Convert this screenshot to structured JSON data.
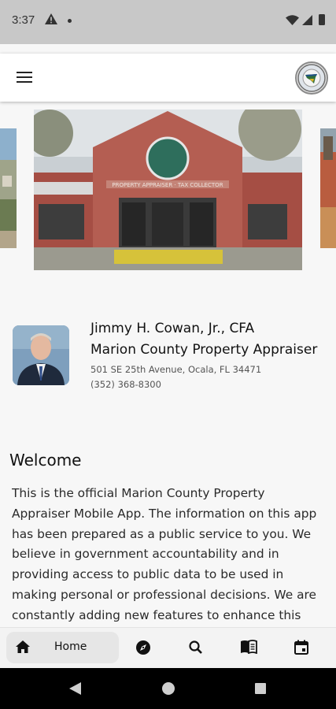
{
  "status_bar": {
    "time": "3:37",
    "icons": [
      "warning-icon",
      "notification-dot-icon",
      "wifi-icon",
      "signal-icon",
      "battery-icon"
    ]
  },
  "app_bar": {
    "menu_icon": "hamburger-menu-icon",
    "logo_icon": "county-seal-logo"
  },
  "carousel": {
    "slides": [
      "previous-slide-photo",
      "marion-county-property-appraiser-building-photo",
      "next-slide-photo"
    ]
  },
  "profile": {
    "name": "Jimmy H. Cowan, Jr., CFA",
    "title": "Marion County Property Appraiser",
    "address": "501 SE 25th Avenue, Ocala, FL 34471",
    "phone": "(352) 368-8300"
  },
  "welcome": {
    "heading": "Welcome",
    "body": "This is the official Marion County Property Appraiser Mobile App. The information on this app has been prepared as a public service to you. We believe in government accountability and in providing access to public data to be used in making personal or professional decisions. We are constantly adding new features to enhance this"
  },
  "bottom_nav": {
    "items": [
      {
        "label": "Home",
        "icon": "home-icon",
        "selected": true
      },
      {
        "label": "",
        "icon": "compass-icon"
      },
      {
        "label": "",
        "icon": "search-icon"
      },
      {
        "label": "",
        "icon": "book-icon"
      },
      {
        "label": "",
        "icon": "calendar-icon"
      }
    ]
  },
  "colors": {
    "status_bar_bg": "#c8c8c8",
    "app_bar_bg": "#ffffff",
    "page_bg": "#f7f7f7",
    "nav_selected_bg": "#e6e6e6",
    "system_nav_bg": "#000000"
  }
}
